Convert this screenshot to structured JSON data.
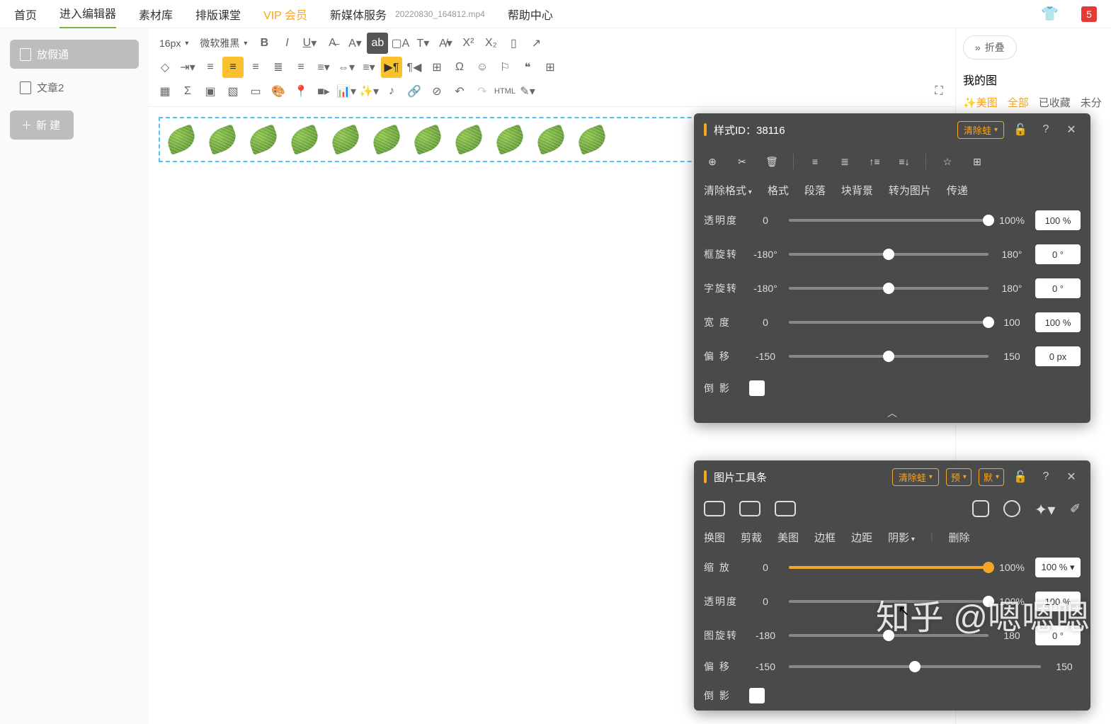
{
  "nav": {
    "home": "首页",
    "editor": "进入编辑器",
    "library": "素材库",
    "layout": "排版课堂",
    "vip": "VIP 会员",
    "media": "新媒体服务",
    "help": "帮助中心",
    "filename": "20220830_164812.mp4",
    "badge": "5"
  },
  "sidebar": {
    "doc1": "放假通",
    "doc2": "文章2",
    "newbtn": "新 建"
  },
  "toolbar": {
    "fontsize": "16px",
    "fontfamily": "微软雅黑"
  },
  "right": {
    "collapse": "折叠",
    "title": "我的图",
    "magic": "美图",
    "all": "全部",
    "fav": "已收藏",
    "un": "未分"
  },
  "panel1": {
    "title": "样式ID：38116",
    "clear": "清除蛙",
    "tabs": [
      "清除格式",
      "格式",
      "段落",
      "块背景",
      "转为图片",
      "传递"
    ],
    "sliders": [
      {
        "label": "透明度",
        "min": "0",
        "max": "100%",
        "val": "100 %",
        "pct": 100,
        "orange": false
      },
      {
        "label": "框旋转",
        "min": "-180°",
        "max": "180°",
        "val": "0    °",
        "pct": 50,
        "orange": false
      },
      {
        "label": "字旋转",
        "min": "-180°",
        "max": "180°",
        "val": "0    °",
        "pct": 50,
        "orange": false
      },
      {
        "label": "宽 度",
        "min": "0",
        "max": "100",
        "val": "100 %",
        "pct": 100,
        "orange": false
      },
      {
        "label": "偏 移",
        "min": "-150",
        "max": "150",
        "val": "0   px",
        "pct": 50,
        "orange": false
      }
    ],
    "reflection": "倒 影"
  },
  "panel2": {
    "title": "图片工具条",
    "clear": "清除蛙",
    "preview": "预",
    "def": "默",
    "tabs": [
      "换图",
      "剪裁",
      "美图",
      "边框",
      "边距",
      "阴影",
      "删除"
    ],
    "sliders": [
      {
        "label": "缩 放",
        "min": "0",
        "max": "100%",
        "val": "100 % ▾",
        "pct": 100,
        "orange": true
      },
      {
        "label": "透明度",
        "min": "0",
        "max": "100%",
        "val": "100 %",
        "pct": 100,
        "orange": false
      },
      {
        "label": "图旋转",
        "min": "-180",
        "max": "180",
        "val": "0    °",
        "pct": 50,
        "orange": false
      },
      {
        "label": "偏 移",
        "min": "-150",
        "max": "150",
        "val": "",
        "pct": 50,
        "orange": false
      }
    ],
    "reflection": "倒 影"
  },
  "watermark": "知乎 @嗯嗯嗯"
}
